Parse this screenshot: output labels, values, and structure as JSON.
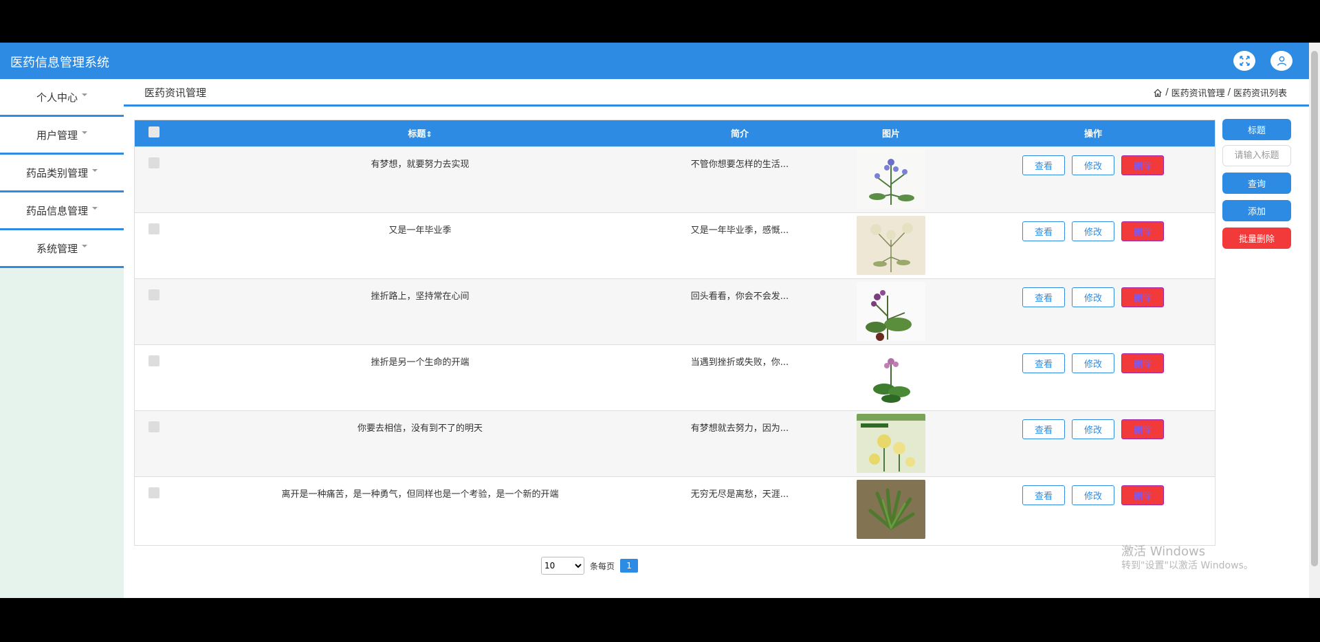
{
  "app": {
    "title": "医药信息管理系统"
  },
  "header": {
    "fullscreen_icon": "fullscreen-icon",
    "user_icon": "user-icon"
  },
  "sidebar": {
    "items": [
      {
        "label": "个人中心"
      },
      {
        "label": "用户管理"
      },
      {
        "label": "药品类别管理"
      },
      {
        "label": "药品信息管理"
      },
      {
        "label": "系统管理"
      }
    ]
  },
  "page": {
    "title": "医药资讯管理",
    "breadcrumb": [
      "医药资讯管理",
      "医药资讯列表"
    ],
    "breadcrumb_sep": "/"
  },
  "table": {
    "headers": {
      "title": "标题",
      "sort_glyph": "⇕",
      "summary": "简介",
      "image": "图片",
      "action": "操作"
    },
    "row_buttons": {
      "view": "查看",
      "edit": "修改",
      "delete": "删除"
    },
    "rows": [
      {
        "title": "有梦想，就要努力去实现",
        "summary": "不管你想要怎样的生活...",
        "image": "plant-illustration-purple-flowers"
      },
      {
        "title": "又是一年毕业季",
        "summary": "又是一年毕业季，感慨...",
        "image": "plant-illustration-white-umbels"
      },
      {
        "title": "挫折路上，坚持常在心间",
        "summary": "回头看看，你会不会发...",
        "image": "plant-illustration-purple-berries"
      },
      {
        "title": "挫折是另一个生命的开端",
        "summary": "当遇到挫折或失败，你...",
        "image": "plant-illustration-pink-flowers"
      },
      {
        "title": "你要去相信，没有到不了的明天",
        "summary": "有梦想就去努力，因为...",
        "image": "book-cover-yellow-flowers"
      },
      {
        "title": "离开是一种痛苦，是一种勇气，但同样也是一个考验，是一个新的开端",
        "summary": "无穷无尽是离愁，天涯...",
        "image": "photo-green-plant"
      }
    ]
  },
  "search": {
    "field_label": "标题",
    "placeholder": "请输入标题",
    "query_label": "查询",
    "add_label": "添加",
    "batch_delete_label": "批量删除"
  },
  "pagination": {
    "page_size": "10",
    "page_size_options": [
      "10"
    ],
    "per_page_label": "条每页",
    "current_page": "1"
  },
  "watermark": {
    "line1": "激活 Windows",
    "line2": "转到\"设置\"以激活 Windows。"
  },
  "colors": {
    "primary": "#2d8be3",
    "danger": "#f23a3a",
    "sidebar_bg": "#e6f2ec"
  }
}
